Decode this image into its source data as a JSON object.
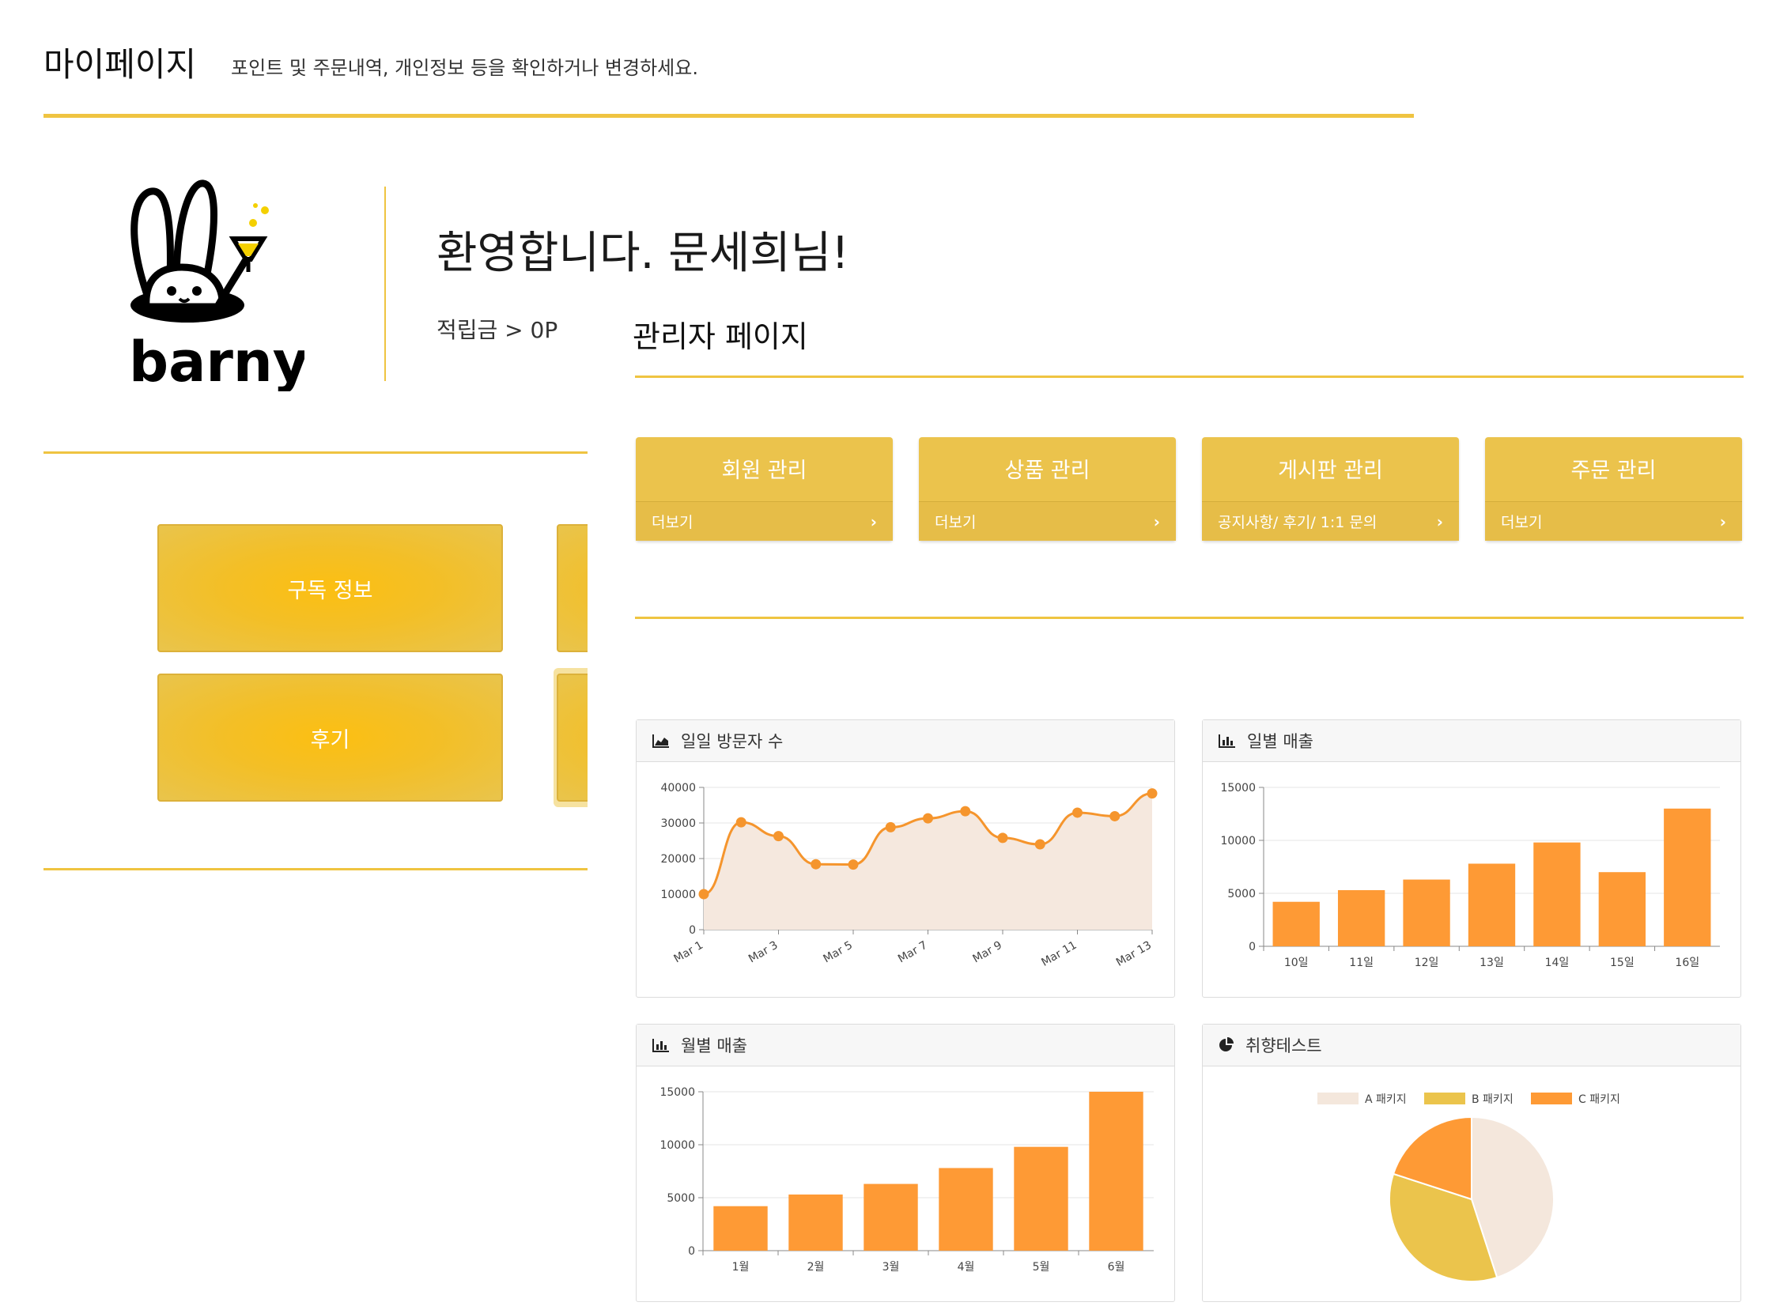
{
  "header": {
    "title": "마이페이지",
    "subtitle": "포인트 및 주문내역, 개인정보 등을 확인하거나 변경하세요."
  },
  "profile": {
    "logo_text": "barny",
    "welcome": "환영합니다. 문세희님!",
    "points": "적립금 > 0P"
  },
  "tiles": [
    {
      "label": "구독 정보"
    },
    {
      "label": "후기"
    }
  ],
  "admin": {
    "title": "관리자 페이지",
    "cards": [
      {
        "title": "회원 관리",
        "footer": "더보기"
      },
      {
        "title": "상품 관리",
        "footer": "더보기"
      },
      {
        "title": "게시판 관리",
        "footer": "공지사항/ 후기/ 1:1 문의"
      },
      {
        "title": "주문 관리",
        "footer": "더보기"
      }
    ]
  },
  "colors": {
    "accent": "#efc441",
    "card": "#ebc34c",
    "bar": "#fe9a35",
    "area_fill": "#f5e8de",
    "line": "#f5952d",
    "pie_a": "#f4e7dc",
    "pie_b": "#ebc44c",
    "pie_c": "#fe9a35"
  },
  "chart_panels": [
    {
      "title": "일일 방문자 수",
      "icon": "area-chart-icon"
    },
    {
      "title": "일별 매출",
      "icon": "bar-chart-icon"
    },
    {
      "title": "월별 매출",
      "icon": "bar-chart-icon"
    },
    {
      "title": "취향테스트",
      "icon": "pie-chart-icon"
    }
  ],
  "chart_data": [
    {
      "type": "area",
      "title": "일일 방문자 수",
      "x": [
        "Mar 1",
        "Mar 2",
        "Mar 3",
        "Mar 4",
        "Mar 5",
        "Mar 6",
        "Mar 7",
        "Mar 8",
        "Mar 9",
        "Mar 10",
        "Mar 11",
        "Mar 12",
        "Mar 13"
      ],
      "x_tick_labels": [
        "Mar 1",
        "Mar 3",
        "Mar 5",
        "Mar 7",
        "Mar 9",
        "Mar 11",
        "Mar 13"
      ],
      "values": [
        10000,
        30200,
        26300,
        18400,
        18300,
        28800,
        31300,
        33300,
        25800,
        24000,
        32900,
        31900,
        38300
      ],
      "ylim": [
        0,
        40000
      ],
      "yticks": [
        0,
        10000,
        20000,
        30000,
        40000
      ],
      "grid": true
    },
    {
      "type": "bar",
      "title": "일별 매출",
      "categories": [
        "10일",
        "11일",
        "12일",
        "13일",
        "14일",
        "15일",
        "16일"
      ],
      "values": [
        4200,
        5300,
        6300,
        7800,
        9800,
        7000,
        13000
      ],
      "ylim": [
        0,
        15000
      ],
      "yticks": [
        0,
        5000,
        10000,
        15000
      ],
      "grid": true
    },
    {
      "type": "bar",
      "title": "월별 매출",
      "categories": [
        "1월",
        "2월",
        "3월",
        "4월",
        "5월",
        "6월"
      ],
      "values": [
        4200,
        5300,
        6300,
        7800,
        9800,
        15000
      ],
      "ylim": [
        0,
        15000
      ],
      "yticks": [
        0,
        5000,
        10000,
        15000
      ],
      "grid": true
    },
    {
      "type": "pie",
      "title": "취향테스트",
      "labels": [
        "A 패키지",
        "B 패키지",
        "C 패키지"
      ],
      "values": [
        45,
        35,
        20
      ],
      "legend": "top"
    }
  ]
}
